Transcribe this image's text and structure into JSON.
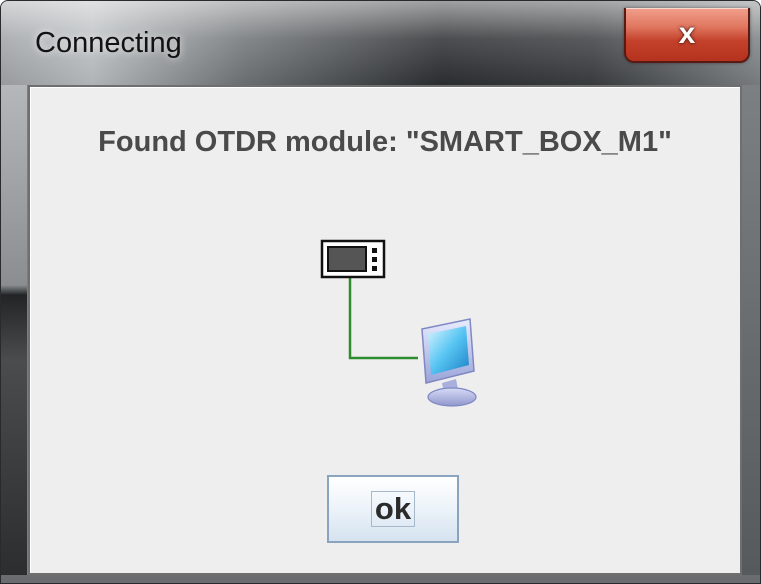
{
  "window": {
    "title": "Connecting",
    "close_label": "x"
  },
  "dialog": {
    "message": "Found OTDR module:  \"SMART_BOX_M1\"",
    "ok_label": "ok"
  },
  "colors": {
    "connection_line": "#2e8b2e",
    "close_button": "#c4412b",
    "dialog_background": "#eeeeee",
    "message_text": "#4a4a4a"
  },
  "icons": {
    "device": "otdr-device-icon",
    "computer": "computer-monitor-icon"
  }
}
